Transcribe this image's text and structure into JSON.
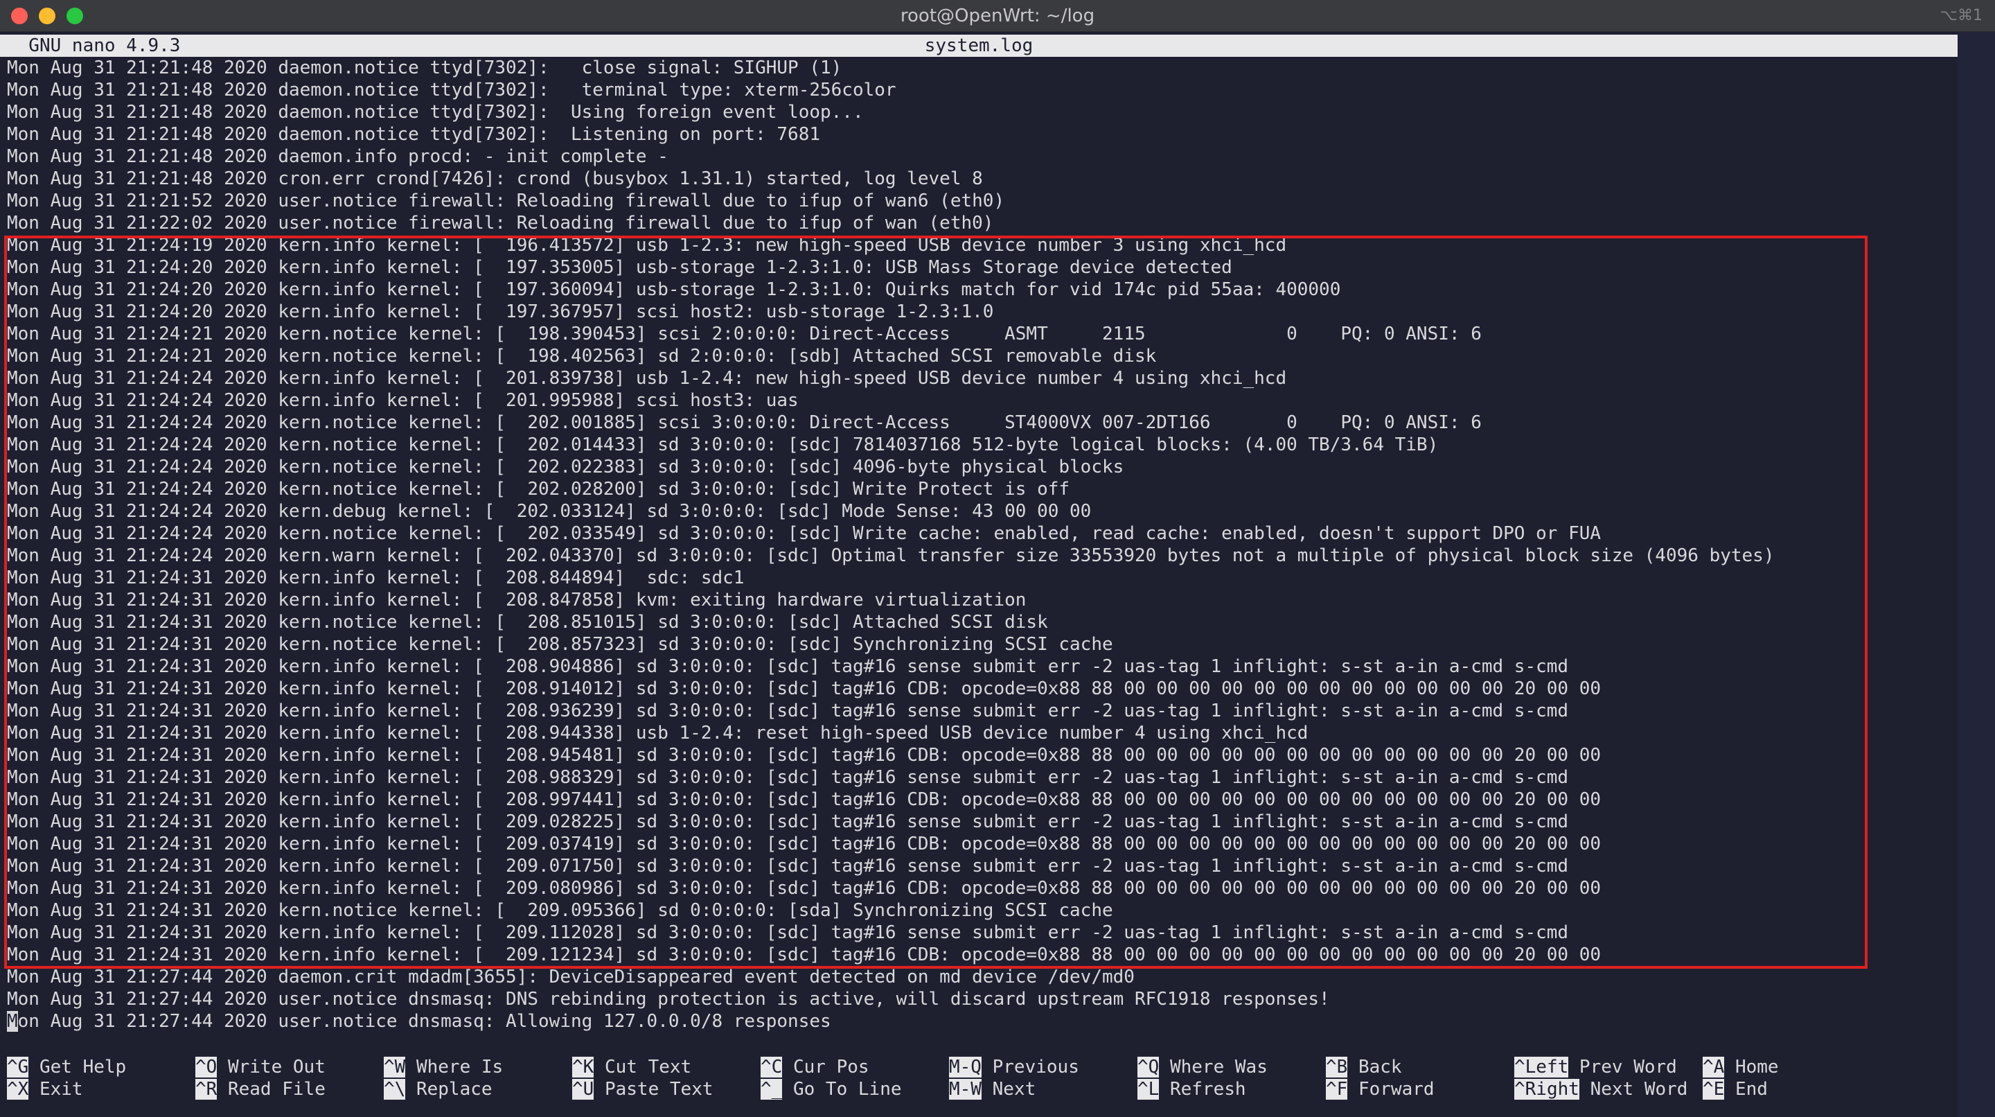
{
  "window": {
    "title": "root@OpenWrt: ~/log",
    "shortcut": "⌥⌘1"
  },
  "nano": {
    "version": "  GNU nano 4.9.3",
    "filename": "system.log"
  },
  "log_lines": [
    "Mon Aug 31 21:21:48 2020 daemon.notice ttyd[7302]:   close signal: SIGHUP (1)",
    "Mon Aug 31 21:21:48 2020 daemon.notice ttyd[7302]:   terminal type: xterm-256color",
    "Mon Aug 31 21:21:48 2020 daemon.notice ttyd[7302]:  Using foreign event loop...",
    "Mon Aug 31 21:21:48 2020 daemon.notice ttyd[7302]:  Listening on port: 7681",
    "Mon Aug 31 21:21:48 2020 daemon.info procd: - init complete -",
    "Mon Aug 31 21:21:48 2020 cron.err crond[7426]: crond (busybox 1.31.1) started, log level 8",
    "Mon Aug 31 21:21:52 2020 user.notice firewall: Reloading firewall due to ifup of wan6 (eth0)",
    "Mon Aug 31 21:22:02 2020 user.notice firewall: Reloading firewall due to ifup of wan (eth0)",
    "Mon Aug 31 21:24:19 2020 kern.info kernel: [  196.413572] usb 1-2.3: new high-speed USB device number 3 using xhci_hcd",
    "Mon Aug 31 21:24:20 2020 kern.info kernel: [  197.353005] usb-storage 1-2.3:1.0: USB Mass Storage device detected",
    "Mon Aug 31 21:24:20 2020 kern.info kernel: [  197.360094] usb-storage 1-2.3:1.0: Quirks match for vid 174c pid 55aa: 400000",
    "Mon Aug 31 21:24:20 2020 kern.info kernel: [  197.367957] scsi host2: usb-storage 1-2.3:1.0",
    "Mon Aug 31 21:24:21 2020 kern.notice kernel: [  198.390453] scsi 2:0:0:0: Direct-Access     ASMT     2115             0    PQ: 0 ANSI: 6",
    "Mon Aug 31 21:24:21 2020 kern.notice kernel: [  198.402563] sd 2:0:0:0: [sdb] Attached SCSI removable disk",
    "Mon Aug 31 21:24:24 2020 kern.info kernel: [  201.839738] usb 1-2.4: new high-speed USB device number 4 using xhci_hcd",
    "Mon Aug 31 21:24:24 2020 kern.info kernel: [  201.995988] scsi host3: uas",
    "Mon Aug 31 21:24:24 2020 kern.notice kernel: [  202.001885] scsi 3:0:0:0: Direct-Access     ST4000VX 007-2DT166       0    PQ: 0 ANSI: 6",
    "Mon Aug 31 21:24:24 2020 kern.notice kernel: [  202.014433] sd 3:0:0:0: [sdc] 7814037168 512-byte logical blocks: (4.00 TB/3.64 TiB)",
    "Mon Aug 31 21:24:24 2020 kern.notice kernel: [  202.022383] sd 3:0:0:0: [sdc] 4096-byte physical blocks",
    "Mon Aug 31 21:24:24 2020 kern.notice kernel: [  202.028200] sd 3:0:0:0: [sdc] Write Protect is off",
    "Mon Aug 31 21:24:24 2020 kern.debug kernel: [  202.033124] sd 3:0:0:0: [sdc] Mode Sense: 43 00 00 00",
    "Mon Aug 31 21:24:24 2020 kern.notice kernel: [  202.033549] sd 3:0:0:0: [sdc] Write cache: enabled, read cache: enabled, doesn't support DPO or FUA",
    "Mon Aug 31 21:24:24 2020 kern.warn kernel: [  202.043370] sd 3:0:0:0: [sdc] Optimal transfer size 33553920 bytes not a multiple of physical block size (4096 bytes)",
    "Mon Aug 31 21:24:31 2020 kern.info kernel: [  208.844894]  sdc: sdc1",
    "Mon Aug 31 21:24:31 2020 kern.info kernel: [  208.847858] kvm: exiting hardware virtualization",
    "Mon Aug 31 21:24:31 2020 kern.notice kernel: [  208.851015] sd 3:0:0:0: [sdc] Attached SCSI disk",
    "Mon Aug 31 21:24:31 2020 kern.notice kernel: [  208.857323] sd 3:0:0:0: [sdc] Synchronizing SCSI cache",
    "Mon Aug 31 21:24:31 2020 kern.info kernel: [  208.904886] sd 3:0:0:0: [sdc] tag#16 sense submit err -2 uas-tag 1 inflight: s-st a-in a-cmd s-cmd",
    "Mon Aug 31 21:24:31 2020 kern.info kernel: [  208.914012] sd 3:0:0:0: [sdc] tag#16 CDB: opcode=0x88 88 00 00 00 00 00 00 00 00 00 00 00 00 20 00 00",
    "Mon Aug 31 21:24:31 2020 kern.info kernel: [  208.936239] sd 3:0:0:0: [sdc] tag#16 sense submit err -2 uas-tag 1 inflight: s-st a-in a-cmd s-cmd",
    "Mon Aug 31 21:24:31 2020 kern.info kernel: [  208.944338] usb 1-2.4: reset high-speed USB device number 4 using xhci_hcd",
    "Mon Aug 31 21:24:31 2020 kern.info kernel: [  208.945481] sd 3:0:0:0: [sdc] tag#16 CDB: opcode=0x88 88 00 00 00 00 00 00 00 00 00 00 00 00 20 00 00",
    "Mon Aug 31 21:24:31 2020 kern.info kernel: [  208.988329] sd 3:0:0:0: [sdc] tag#16 sense submit err -2 uas-tag 1 inflight: s-st a-in a-cmd s-cmd",
    "Mon Aug 31 21:24:31 2020 kern.info kernel: [  208.997441] sd 3:0:0:0: [sdc] tag#16 CDB: opcode=0x88 88 00 00 00 00 00 00 00 00 00 00 00 00 20 00 00",
    "Mon Aug 31 21:24:31 2020 kern.info kernel: [  209.028225] sd 3:0:0:0: [sdc] tag#16 sense submit err -2 uas-tag 1 inflight: s-st a-in a-cmd s-cmd",
    "Mon Aug 31 21:24:31 2020 kern.info kernel: [  209.037419] sd 3:0:0:0: [sdc] tag#16 CDB: opcode=0x88 88 00 00 00 00 00 00 00 00 00 00 00 00 20 00 00",
    "Mon Aug 31 21:24:31 2020 kern.info kernel: [  209.071750] sd 3:0:0:0: [sdc] tag#16 sense submit err -2 uas-tag 1 inflight: s-st a-in a-cmd s-cmd",
    "Mon Aug 31 21:24:31 2020 kern.info kernel: [  209.080986] sd 3:0:0:0: [sdc] tag#16 CDB: opcode=0x88 88 00 00 00 00 00 00 00 00 00 00 00 00 20 00 00",
    "Mon Aug 31 21:24:31 2020 kern.notice kernel: [  209.095366] sd 0:0:0:0: [sda] Synchronizing SCSI cache",
    "Mon Aug 31 21:24:31 2020 kern.info kernel: [  209.112028] sd 3:0:0:0: [sdc] tag#16 sense submit err -2 uas-tag 1 inflight: s-st a-in a-cmd s-cmd",
    "Mon Aug 31 21:24:31 2020 kern.info kernel: [  209.121234] sd 3:0:0:0: [sdc] tag#16 CDB: opcode=0x88 88 00 00 00 00 00 00 00 00 00 00 00 00 20 00 00",
    "Mon Aug 31 21:27:44 2020 daemon.crit mdadm[3655]: DeviceDisappeared event detected on md device /dev/md0",
    "Mon Aug 31 21:27:44 2020 user.notice dnsmasq: DNS rebinding protection is active, will discard upstream RFC1918 responses!",
    "Mon Aug 31 21:27:44 2020 user.notice dnsmasq: Allowing 127.0.0.0/8 responses"
  ],
  "cursor_line": {
    "first_char": "M",
    "rest": "on Aug 31 21:27:44 2020 user.notice dnsmasq: Allowing 127.0.0.0/8 responses"
  },
  "shortcuts": [
    {
      "key": "^G",
      "label": " Get Help"
    },
    {
      "key": "^O",
      "label": " Write Out"
    },
    {
      "key": "^W",
      "label": " Where Is"
    },
    {
      "key": "^K",
      "label": " Cut Text"
    },
    {
      "key": "^C",
      "label": " Cur Pos"
    },
    {
      "key": "M-Q",
      "label": " Previous"
    },
    {
      "key": "^Q",
      "label": " Where Was"
    },
    {
      "key": "^B",
      "label": " Back"
    },
    {
      "key": "^Left",
      "label": " Prev Word"
    },
    {
      "key": "^A",
      "label": " Home"
    },
    {
      "key": "^X",
      "label": " Exit"
    },
    {
      "key": "^R",
      "label": " Read File"
    },
    {
      "key": "^\\",
      "label": " Replace"
    },
    {
      "key": "^U",
      "label": " Paste Text"
    },
    {
      "key": "^_",
      "label": " Go To Line"
    },
    {
      "key": "M-W",
      "label": " Next"
    },
    {
      "key": "^L",
      "label": " Refresh"
    },
    {
      "key": "^F",
      "label": " Forward"
    },
    {
      "key": "^Right",
      "label": " Next Word"
    },
    {
      "key": "^E",
      "label": " End"
    }
  ],
  "colors": {
    "background": "#1e2030",
    "text": "#d8d8dc",
    "highlight_border": "#e02020"
  }
}
